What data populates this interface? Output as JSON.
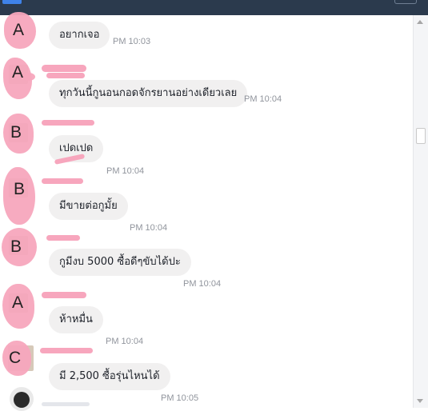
{
  "messages": [
    {
      "sender": "A",
      "text": "อยากเจอ",
      "time": "PM 10:03"
    },
    {
      "sender": "A",
      "text": "ทุกวันนี้กูนอนกอดจักรยานอย่างเดียวเลย",
      "time": "PM 10:04"
    },
    {
      "sender": "B",
      "text": "เปดเปด",
      "time": "PM 10:04"
    },
    {
      "sender": "B",
      "text": "มีขายต่อกูมั้ย",
      "time": "PM 10:04"
    },
    {
      "sender": "B",
      "text": "กูมีงบ 5000 ซื้อดีๆขับได้ปะ",
      "time": "PM 10:04"
    },
    {
      "sender": "A",
      "text": "ห้าหมื่น",
      "time": "PM 10:04"
    },
    {
      "sender": "C",
      "text": "มี 2,500 ซื้อรุ่นไหนได้",
      "time": "PM 10:05"
    }
  ],
  "colors": {
    "bubble": "#f1f0f0",
    "scribble": "#f7a6bd",
    "topbar": "#2b3a4d"
  },
  "icons": [
    "scroll-up-arrow-icon",
    "scroll-down-arrow-icon"
  ]
}
